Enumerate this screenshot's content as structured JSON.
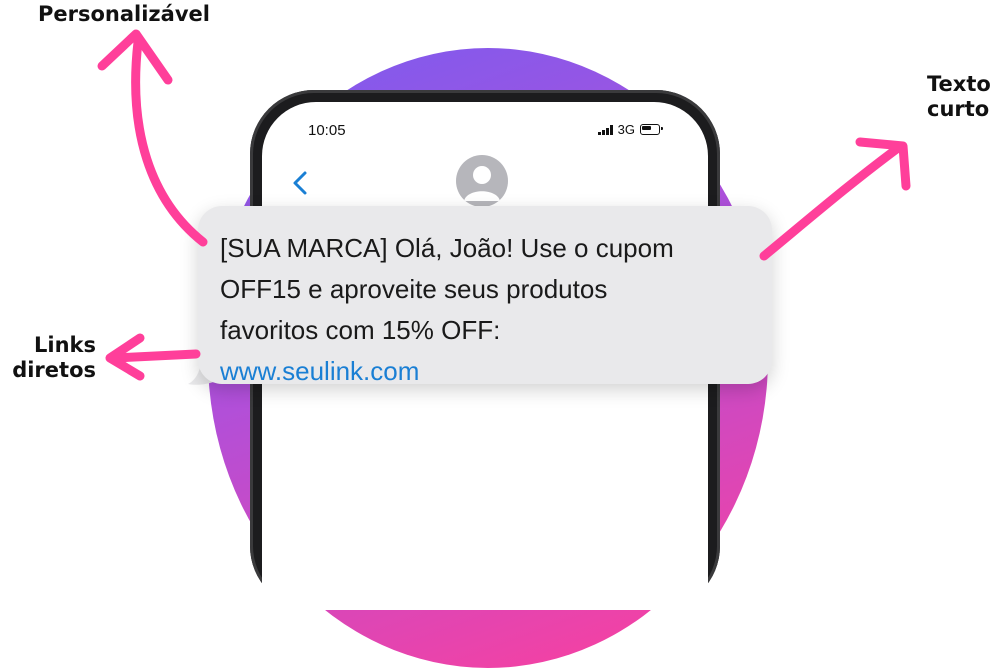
{
  "callouts": {
    "personalizable": "Personalizável",
    "short_text_line1": "Texto",
    "short_text_line2": "curto",
    "direct_links_line1": "Links",
    "direct_links_line2": "diretos"
  },
  "phone": {
    "status_time": "10:05",
    "network": "3G",
    "message": {
      "line1": "[SUA MARCA] Olá, João! Use o cupom",
      "line2": "OFF15 e aproveite seus produtos",
      "line3": "favoritos com 15% OFF:",
      "link": "www.seulink.com"
    }
  },
  "colors": {
    "accent_pink": "#ff3f9a",
    "blob_purple": "#7a5cf0",
    "link_blue": "#1a7fd4",
    "bubble_gray": "#e9e9eb"
  },
  "icons": [
    "back-chevron-icon",
    "contact-avatar-icon",
    "signal-icon",
    "battery-icon",
    "arrow-icon"
  ]
}
